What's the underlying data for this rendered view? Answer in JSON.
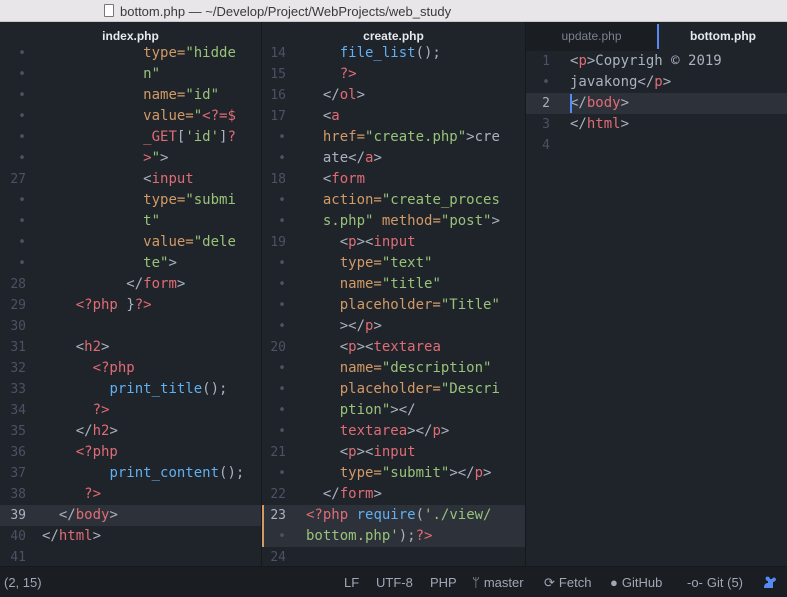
{
  "window": {
    "title": "bottom.php — ~/Develop/Project/WebProjects/web_study"
  },
  "panes": {
    "left": {
      "tab": "index.php"
    },
    "middle": {
      "tab": "create.php"
    },
    "right": {
      "tabs": [
        "update.php",
        "bottom.php"
      ]
    }
  },
  "status": {
    "cursor_position": "(2, 15)",
    "line_ending": "LF",
    "encoding": "UTF-8",
    "grammar": "PHP",
    "branch": "master",
    "fetch": "Fetch",
    "github": "GitHub",
    "git": "Git (5)"
  },
  "left_gutter": [
    "•",
    "•",
    "•",
    "•",
    "•",
    "27",
    "•",
    "•",
    "•",
    "•",
    "28",
    "29",
    "30",
    "31",
    "32",
    "33",
    "34",
    "35",
    "36",
    "37",
    "38",
    "39",
    "40",
    "41"
  ],
  "middle_gutter": [
    "14",
    "15",
    "16",
    "17",
    "•",
    "•",
    "18",
    "•",
    "•",
    "19",
    "•",
    "•",
    "•",
    "•",
    "20",
    "•",
    "•",
    "•",
    "•",
    "21",
    "•",
    "22",
    "23",
    "•",
    "24"
  ],
  "right_gutter": [
    "1",
    "•",
    "2",
    "3",
    "4"
  ],
  "colors": {
    "accent": "#568af2",
    "tag": "#e06c75",
    "attr": "#d19a66",
    "string": "#98c379",
    "func": "#61afef"
  }
}
